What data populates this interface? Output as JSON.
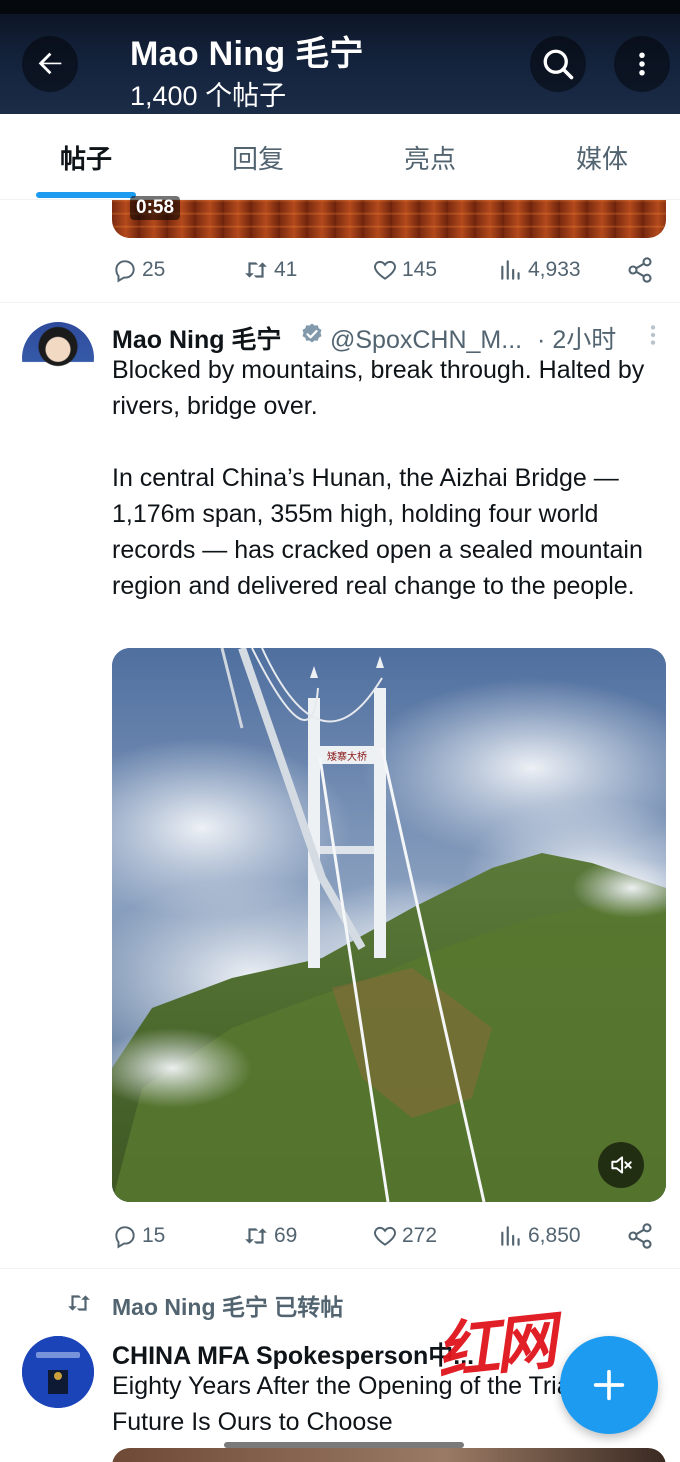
{
  "header": {
    "title": "Mao Ning 毛宁",
    "post_count": "1,400 个帖子"
  },
  "tabs": [
    {
      "label": "帖子",
      "active": true
    },
    {
      "label": "回复",
      "active": false
    },
    {
      "label": "亮点",
      "active": false
    },
    {
      "label": "媒体",
      "active": false
    }
  ],
  "previous_post": {
    "video_time": "0:58",
    "replies": "25",
    "reposts": "41",
    "likes": "145",
    "views": "4,933"
  },
  "tweet": {
    "name": "Mao Ning 毛宁",
    "handle": "@SpoxCHN_M...",
    "time": "· 2小时",
    "paragraph1": "Blocked by mountains, break through. Halted by rivers, bridge over.",
    "paragraph2": "In central China’s Hunan, the Aizhai Bridge — 1,176m span, 355m high, holding four world records — has cracked open a sealed mountain region and delivered real change to the people.",
    "bridge_sign": "矮寨大桥",
    "replies": "15",
    "reposts": "69",
    "likes": "272",
    "views": "6,850"
  },
  "retweet": {
    "label": "Mao Ning 毛宁 已转帖",
    "name": "CHINA MFA Spokesperson中...",
    "text": "Eighty Years After the Opening of the Trials: The Future Is Ours to Choose"
  },
  "watermark": "红网",
  "colors": {
    "accent": "#1d9bf0",
    "text": "#0f1419",
    "secondary": "#536471",
    "header_bg": "#14233d"
  }
}
